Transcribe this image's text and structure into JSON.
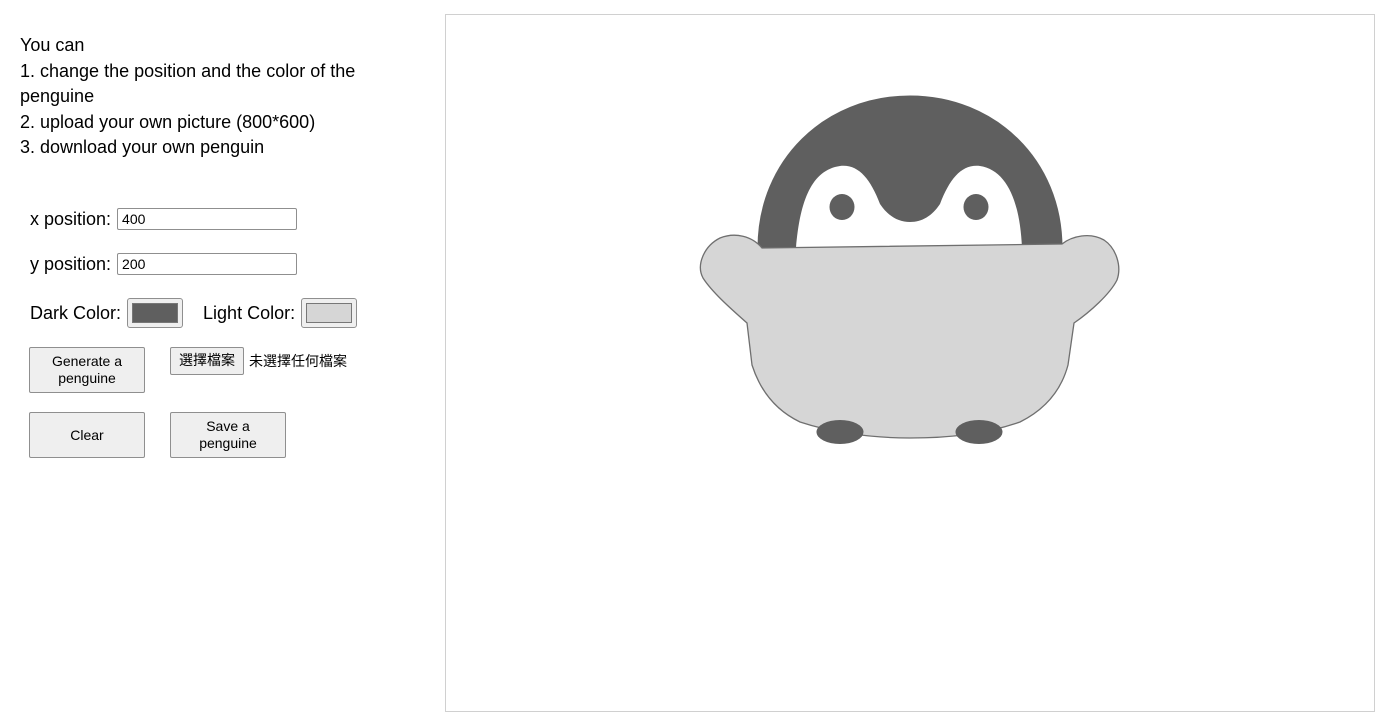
{
  "instructions": {
    "intro": "You can",
    "step1": "1. change the position and the color of the penguine",
    "step2": "2. upload your own picture (800*600)",
    "step3": "3. download your own penguin"
  },
  "form": {
    "x_label": "x position:",
    "x_value": "400",
    "y_label": "y position:",
    "y_value": "200",
    "dark_label": "Dark Color:",
    "dark_color": "#5f5f5f",
    "light_label": "Light Color:",
    "light_color": "#d6d6d6"
  },
  "buttons": {
    "generate": "Generate a penguine",
    "file_choose": "選擇檔案",
    "file_status": "未選擇任何檔案",
    "clear": "Clear",
    "save": "Save a penguine"
  },
  "colors": {
    "dark": "#5f5f5f",
    "light": "#d6d6d6",
    "white": "#ffffff"
  }
}
